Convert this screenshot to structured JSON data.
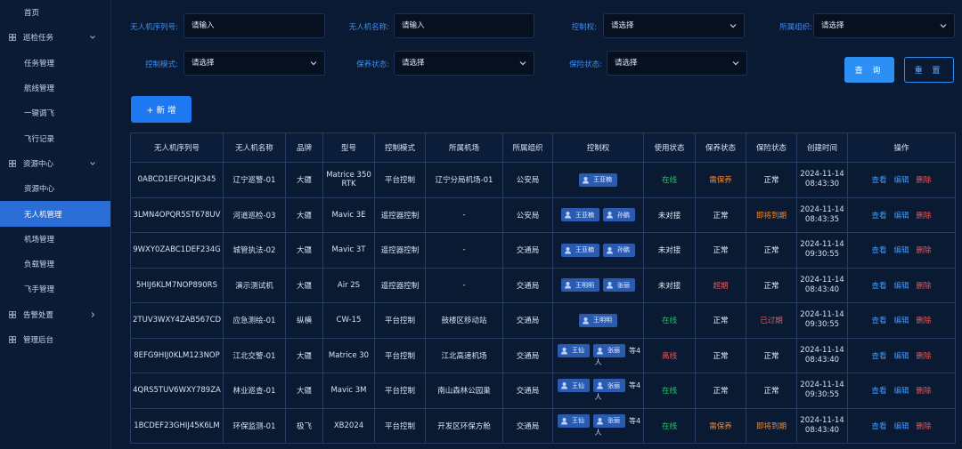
{
  "sidebar": {
    "items": [
      {
        "label": "首页",
        "kind": "home",
        "active": false,
        "icon": ""
      },
      {
        "label": "巡检任务",
        "kind": "top",
        "active": false,
        "icon": "grid-icon",
        "chevron": "down"
      },
      {
        "label": "任务管理",
        "kind": "sub",
        "active": false
      },
      {
        "label": "航线管理",
        "kind": "sub",
        "active": false
      },
      {
        "label": "一键调飞",
        "kind": "sub",
        "active": false
      },
      {
        "label": "飞行记录",
        "kind": "sub",
        "active": false
      },
      {
        "label": "资源中心",
        "kind": "top",
        "active": false,
        "icon": "grid-icon",
        "chevron": "down"
      },
      {
        "label": "资源中心",
        "kind": "sub",
        "active": false
      },
      {
        "label": "无人机管理",
        "kind": "sub",
        "active": true
      },
      {
        "label": "机场管理",
        "kind": "sub",
        "active": false
      },
      {
        "label": "负载管理",
        "kind": "sub",
        "active": false
      },
      {
        "label": "飞手管理",
        "kind": "sub",
        "active": false
      },
      {
        "label": "告警处置",
        "kind": "top",
        "active": false,
        "icon": "grid-icon",
        "chevron": "right"
      },
      {
        "label": "管理后台",
        "kind": "top",
        "active": false,
        "icon": "grid-icon"
      }
    ]
  },
  "filters": {
    "serial": {
      "label": "无人机序列号:",
      "placeholder": "请输入"
    },
    "name": {
      "label": "无人机名称:",
      "placeholder": "请输入"
    },
    "control_right": {
      "label": "控制权:",
      "placeholder": "请选择"
    },
    "org": {
      "label": "所属组织:",
      "placeholder": "请选择"
    },
    "control_mode": {
      "label": "控制模式:",
      "placeholder": "请选择"
    },
    "maintenance": {
      "label": "保养状态:",
      "placeholder": "请选择"
    },
    "insurance": {
      "label": "保险状态:",
      "placeholder": "请选择"
    }
  },
  "buttons": {
    "query": "查 询",
    "reset": "重 置",
    "add": "+ 新 增"
  },
  "table": {
    "columns": [
      "无人机序列号",
      "无人机名称",
      "品牌",
      "型号",
      "控制模式",
      "所属机场",
      "所属组织",
      "控制权",
      "使用状态",
      "保养状态",
      "保险状态",
      "创建时间",
      "操作"
    ],
    "ops": {
      "view": "查看",
      "edit": "编辑",
      "delete": "删除"
    },
    "rows": [
      {
        "serial": "0ABCD1EFGH2JK345",
        "name": "辽宁巡警-01",
        "brand": "大疆",
        "model": "Matrice 350 RTK",
        "mode": "平台控制",
        "airport": "辽宁分局机场-01",
        "org": "公安局",
        "controllers": [
          "王亚楠"
        ],
        "more": "",
        "use": "在线",
        "use_color": "green",
        "maint": "需保养",
        "maint_color": "orange",
        "ins": "正常",
        "ins_color": "white",
        "date": "2024-11-14",
        "time": "08:43:30"
      },
      {
        "serial": "3LMN4OPQR5ST678UV",
        "name": "河道巡检-03",
        "brand": "大疆",
        "model": "Mavic 3E",
        "mode": "遥控器控制",
        "airport": "-",
        "org": "公安局",
        "controllers": [
          "王亚楠",
          "孙鹏"
        ],
        "more": "",
        "use": "未对接",
        "use_color": "white",
        "maint": "正常",
        "maint_color": "white",
        "ins": "即将到期",
        "ins_color": "orange",
        "date": "2024-11-14",
        "time": "08:43:35"
      },
      {
        "serial": "9WXY0ZABC1DEF234G",
        "name": "城管执法-02",
        "brand": "大疆",
        "model": "Mavic 3T",
        "mode": "遥控器控制",
        "airport": "-",
        "org": "交通局",
        "controllers": [
          "王亚楠",
          "孙鹏"
        ],
        "more": "",
        "use": "未对接",
        "use_color": "white",
        "maint": "正常",
        "maint_color": "white",
        "ins": "正常",
        "ins_color": "white",
        "date": "2024-11-14",
        "time": "09:30:55"
      },
      {
        "serial": "5HIJ6KLM7NOP890RS",
        "name": "演示测试机",
        "brand": "大疆",
        "model": "Air 2S",
        "mode": "遥控器控制",
        "airport": "-",
        "org": "交通局",
        "controllers": [
          "王明明",
          "张丽"
        ],
        "more": "",
        "use": "未对接",
        "use_color": "white",
        "maint": "超期",
        "maint_color": "red",
        "ins": "正常",
        "ins_color": "white",
        "date": "2024-11-14",
        "time": "08:43:40"
      },
      {
        "serial": "2TUV3WXY4ZAB567CD",
        "name": "应急测绘-01",
        "brand": "纵横",
        "model": "CW-15",
        "mode": "平台控制",
        "airport": "鼓楼区移动站",
        "org": "交通局",
        "controllers": [
          "王明明"
        ],
        "more": "",
        "use": "在线",
        "use_color": "green",
        "maint": "正常",
        "maint_color": "white",
        "ins": "已过期",
        "ins_color": "red",
        "date": "2024-11-14",
        "time": "09:30:55"
      },
      {
        "serial": "8EFG9HIJ0KLM123NOP",
        "name": "江北交警-01",
        "brand": "大疆",
        "model": "Matrice 30",
        "mode": "平台控制",
        "airport": "江北高速机场",
        "org": "交通局",
        "controllers": [
          "王仙",
          "张丽"
        ],
        "more": "等4人",
        "use": "离线",
        "use_color": "red",
        "maint": "正常",
        "maint_color": "white",
        "ins": "正常",
        "ins_color": "white",
        "date": "2024-11-14",
        "time": "08:43:40"
      },
      {
        "serial": "4QRS5TUV6WXY789ZA",
        "name": "林业巡查-01",
        "brand": "大疆",
        "model": "Mavic 3M",
        "mode": "平台控制",
        "airport": "南山森林公园巢",
        "org": "交通局",
        "controllers": [
          "王仙",
          "张丽"
        ],
        "more": "等4人",
        "use": "在线",
        "use_color": "green",
        "maint": "正常",
        "maint_color": "white",
        "ins": "正常",
        "ins_color": "white",
        "date": "2024-11-14",
        "time": "09:30:55"
      },
      {
        "serial": "1BCDEF23GHIJ45K6LM",
        "name": "环保监测-01",
        "brand": "极飞",
        "model": "XB2024",
        "mode": "平台控制",
        "airport": "开发区环保方舱",
        "org": "交通局",
        "controllers": [
          "王仙",
          "张丽"
        ],
        "more": "等4人",
        "use": "在线",
        "use_color": "green",
        "maint": "需保养",
        "maint_color": "orange",
        "ins": "即将到期",
        "ins_color": "orange",
        "date": "2024-11-14",
        "time": "08:43:40"
      }
    ]
  }
}
